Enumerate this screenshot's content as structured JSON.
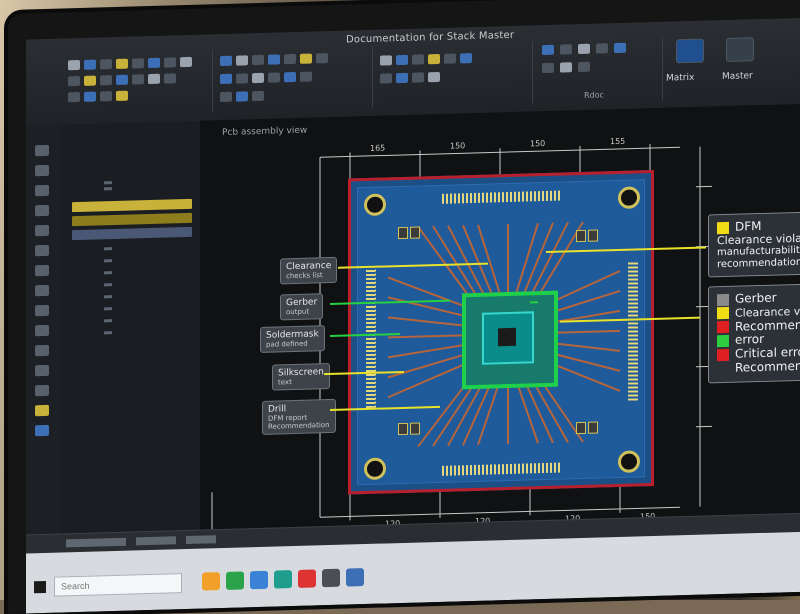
{
  "app": {
    "window_title": "Documentation for Stack Master",
    "canvas_title": "Pcb assembly view"
  },
  "ribbon": {
    "groups": [
      {
        "label": "Rdoc"
      },
      {
        "label": "Matrix"
      },
      {
        "label": "Master"
      }
    ]
  },
  "layers": [
    {
      "color": "#c9b23a"
    },
    {
      "color": "#8e7d1d"
    },
    {
      "color": "#4a5876"
    }
  ],
  "callouts_left": [
    {
      "title": "Clearance",
      "sub": "checks list"
    },
    {
      "title": "Gerber",
      "sub": "output"
    },
    {
      "title": "Soldermask",
      "sub": "pad defined"
    },
    {
      "title": "Silkscreen",
      "sub": "text"
    },
    {
      "title": "Drill",
      "sub": "DFM report",
      "sub2": "Recommendation"
    }
  ],
  "right_panel_1": {
    "title": "DFM",
    "lines": [
      "Clearance violations",
      "manufacturability",
      "recommendations"
    ],
    "swatch": "#f2dc15"
  },
  "right_panel_2": {
    "items": [
      {
        "label": "Gerber",
        "color": "#8a8a8a"
      },
      {
        "label": "Clearance violations",
        "color": "#f2dc15"
      },
      {
        "label": "Recommendation",
        "color": "#e02020"
      },
      {
        "label": "error",
        "color": "#2ecc40"
      },
      {
        "label": "Critical error",
        "color": "#e02020"
      },
      {
        "label": "Recommendation",
        "color": ""
      }
    ]
  },
  "dimensions": {
    "top": [
      "165",
      "150",
      "150",
      "155"
    ],
    "bottom": [
      "120",
      "120",
      "120",
      "150"
    ]
  },
  "taskbar": {
    "search_placeholder": "Search"
  },
  "colors": {
    "board_blue": "#1f5a9a",
    "outline_red": "#b8202e",
    "chip_green": "#1fd04a",
    "pad_gold": "#e5d77a"
  }
}
